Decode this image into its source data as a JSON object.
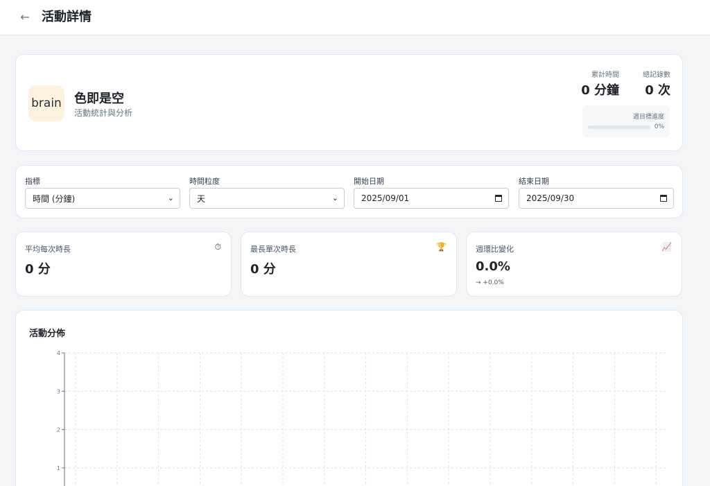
{
  "header": {
    "back_icon": "←",
    "title": "活動詳情"
  },
  "activity": {
    "icon_text": "brain",
    "name": "色即是空",
    "subtitle": "活動統計與分析",
    "total_time_label": "累計時間",
    "total_time_value": "0 分鐘",
    "total_records_label": "總記錄數",
    "total_records_value": "0 次",
    "weekly_progress_label": "週目標進度",
    "weekly_progress_value": "0%",
    "weekly_progress_fraction": 0,
    "accent_color": "#3b82f6"
  },
  "filters": {
    "metric_label": "指標",
    "metric_value": "時間 (分鐘)",
    "granularity_label": "時間粒度",
    "granularity_value": "天",
    "start_label": "開始日期",
    "start_value": "2025/09/01",
    "end_label": "結束日期",
    "end_value": "2025/09/30"
  },
  "metrics": [
    {
      "label": "平均每次時長",
      "value": "0 分",
      "icon": "stopwatch-icon",
      "glyph": "⏱"
    },
    {
      "label": "最長單次時長",
      "value": "0 分",
      "icon": "trophy-icon",
      "glyph": "🏆"
    },
    {
      "label": "週環比變化",
      "value": "0.0%",
      "sub": "→ +0.0%",
      "icon": "chart-increasing-icon",
      "glyph": "📈"
    }
  ],
  "chart_data": {
    "type": "bar",
    "title": "活動分佈",
    "y_ticks": [
      "1",
      "2",
      "3",
      "4"
    ],
    "ylim": [
      0,
      4
    ],
    "grid": true,
    "categories": [],
    "values": []
  }
}
